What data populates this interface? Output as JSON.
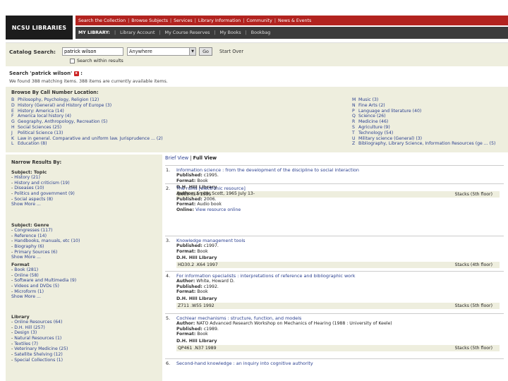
{
  "header": {
    "logo": "NCSU LIBRARIES",
    "top_nav": [
      "Search the Collection",
      "Browse Subjects",
      "Services",
      "Library Information",
      "Community",
      "News & Events"
    ],
    "my_library_label": "MY LIBRARY:",
    "my_library_links": [
      "Library Account",
      "My Course Reserves",
      "My Books",
      "Bookbag"
    ]
  },
  "search": {
    "label": "Catalog Search:",
    "query": "patrick wilson",
    "scope": "Anywhere",
    "go": "Go",
    "start_over": "Start Over",
    "within_label": "Search within results"
  },
  "summary": {
    "title": "Search 'patrick wilson'",
    "x_icon": "x",
    "colon": ":",
    "found": "We found 388 matching items. 388 items are currently available items."
  },
  "callnumber": {
    "heading": "Browse By Call Number Location:",
    "left": [
      {
        "code": "B",
        "label": "Philosophy, Psychology, Religion (12)"
      },
      {
        "code": "D",
        "label": "History (General) and History of Europe (3)"
      },
      {
        "code": "E",
        "label": "History: America (14)"
      },
      {
        "code": "F",
        "label": "America local history (4)"
      },
      {
        "code": "G",
        "label": "Geography, Anthropology, Recreation (5)"
      },
      {
        "code": "H",
        "label": "Social Sciences (25)"
      },
      {
        "code": "J",
        "label": "Political Science (13)"
      },
      {
        "code": "K",
        "label": "Law in general. Comparative and uniform law. Jurisprudence ... (2)"
      },
      {
        "code": "L",
        "label": "Education (8)"
      }
    ],
    "right": [
      {
        "code": "M",
        "label": "Music (3)"
      },
      {
        "code": "N",
        "label": "Fine Arts (2)"
      },
      {
        "code": "P",
        "label": "Language and literature (40)"
      },
      {
        "code": "Q",
        "label": "Science (26)"
      },
      {
        "code": "R",
        "label": "Medicine (46)"
      },
      {
        "code": "S",
        "label": "Agriculture (9)"
      },
      {
        "code": "T",
        "label": "Technology (54)"
      },
      {
        "code": "U",
        "label": "Military science (General) (3)"
      },
      {
        "code": "Z",
        "label": "Bibliography, Library Science, Information Resources (ge ... (5)"
      }
    ]
  },
  "facets": {
    "heading": "Narrow Results By:",
    "groups": [
      {
        "title": "Subject: Topic",
        "items": [
          "History (21)",
          "History and criticism (19)",
          "Diseases (10)",
          "Politics and government (9)",
          "Social aspects (8)"
        ],
        "more": "Show More ..."
      },
      {
        "title": "Subject: Genre",
        "items": [
          "Congresses (117)",
          "Reference (14)",
          "Handbooks, manuals, etc (10)",
          "Biography (6)",
          "Primary Sources (6)"
        ],
        "more": "Show More ..."
      },
      {
        "title": "Format",
        "items": [
          "Book (281)",
          "Online (58)",
          "Software and Multimedia (9)",
          "Videos and DVDs (5)",
          "Microform (1)"
        ],
        "more": "Show More ..."
      },
      {
        "title": "Library",
        "items": [
          "Online Resources (64)",
          "D.H. Hill (257)",
          "Design (3)",
          "Natural Resources (1)",
          "Textiles (7)",
          "Veterinary Medicine (25)",
          "Satellite Shelving (12)",
          "Special Collections (1)"
        ],
        "more": ""
      }
    ]
  },
  "results": {
    "view_tabs": {
      "brief": "Brief View",
      "sep": "|",
      "full": "Full View"
    },
    "records": [
      {
        "num": "1.",
        "title": "Information science : from the development of the discipline to social interaction",
        "lines": [
          [
            "Published:",
            "c1995."
          ],
          [
            "Format:",
            "Book"
          ]
        ],
        "location": "D.H. Hill Library",
        "call": "Z665 .I54 1995",
        "shelf": "Stacks (5th floor)"
      },
      {
        "num": "2.",
        "title": "The ruins [electronic resource]",
        "lines": [
          [
            "Author:",
            "Smith, Scott, 1965 July 13-"
          ],
          [
            "Published:",
            "2006."
          ],
          [
            "Format:",
            "Audio book"
          ],
          [
            "Online:",
            "View resource online"
          ]
        ],
        "location": "",
        "call": "",
        "shelf": ""
      },
      {
        "num": "3.",
        "title": "Knowledge management tools",
        "lines": [
          [
            "Published:",
            "c1997."
          ],
          [
            "Format:",
            "Book"
          ]
        ],
        "location": "D.H. Hill Library",
        "call": "HD30.2 .K64 1997",
        "shelf": "Stacks (4th floor)"
      },
      {
        "num": "4.",
        "title": "For information specialists : interpretations of reference and bibliographic work",
        "lines": [
          [
            "Author:",
            "White, Howard D."
          ],
          [
            "Published:",
            "c1992."
          ],
          [
            "Format:",
            "Book"
          ]
        ],
        "location": "D.H. Hill Library",
        "call": "Z711 .W55 1992",
        "shelf": "Stacks (5th floor)"
      },
      {
        "num": "5.",
        "title": "Cochlear mechanisms : structure, function, and models",
        "lines": [
          [
            "Author:",
            "NATO Advanced Research Workshop on Mechanics of Hearing (1988 : University of Keele)"
          ],
          [
            "Published:",
            "c1989."
          ],
          [
            "Format:",
            "Book"
          ]
        ],
        "location": "D.H. Hill Library",
        "call": "QP461 .N37 1989",
        "shelf": "Stacks (5th floor)"
      },
      {
        "num": "6.",
        "title": "Second-hand knowledge : an inquiry into cognitive authority",
        "lines": [],
        "location": "",
        "call": "",
        "shelf": ""
      }
    ]
  },
  "colors": {
    "red_bar": "#b2231f",
    "gray_bar": "#3b3b3b",
    "panel": "#eeeede",
    "link": "#2a3f8f"
  }
}
